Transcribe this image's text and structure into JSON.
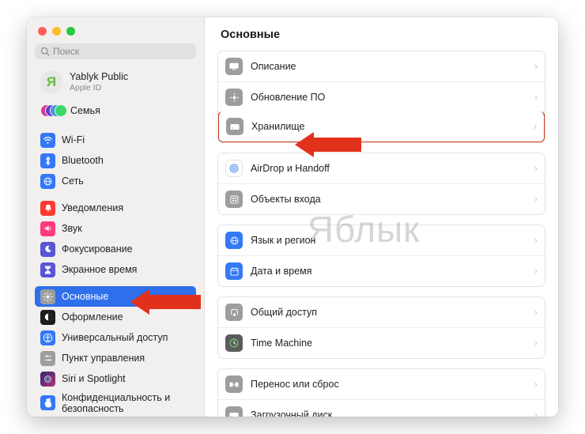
{
  "watermark": "Яблык",
  "colors": {
    "accent_blue": "#2f6fec",
    "highlight_red": "#cf3a25",
    "arrow_red": "#e2311b"
  },
  "search": {
    "placeholder": "Поиск"
  },
  "account": {
    "name": "Yablyk Public",
    "sub": "Apple ID"
  },
  "sidebar": {
    "family": "Семья",
    "items": [
      {
        "label": "Wi-Fi"
      },
      {
        "label": "Bluetooth"
      },
      {
        "label": "Сеть"
      },
      {
        "label": "Уведомления"
      },
      {
        "label": "Звук"
      },
      {
        "label": "Фокусирование"
      },
      {
        "label": "Экранное время"
      },
      {
        "label": "Основные"
      },
      {
        "label": "Оформление"
      },
      {
        "label": "Универсальный доступ"
      },
      {
        "label": "Пункт управления"
      },
      {
        "label": "Siri и Spotlight"
      },
      {
        "label": "Конфиденциальность и безопасность"
      }
    ]
  },
  "main": {
    "title": "Основные",
    "groups": [
      [
        {
          "label": "Описание",
          "icon": "about-icon"
        },
        {
          "label": "Обновление ПО",
          "icon": "update-icon"
        },
        {
          "label": "Хранилище",
          "icon": "storage-icon",
          "highlighted": true
        }
      ],
      [
        {
          "label": "AirDrop и Handoff",
          "icon": "airdrop-icon"
        },
        {
          "label": "Объекты входа",
          "icon": "login-items-icon"
        }
      ],
      [
        {
          "label": "Язык и регион",
          "icon": "language-icon"
        },
        {
          "label": "Дата и время",
          "icon": "datetime-icon"
        }
      ],
      [
        {
          "label": "Общий доступ",
          "icon": "sharing-icon"
        },
        {
          "label": "Time Machine",
          "icon": "timemachine-icon"
        }
      ],
      [
        {
          "label": "Перенос или сброс",
          "icon": "transfer-icon"
        },
        {
          "label": "Загрузочный диск",
          "icon": "startup-icon"
        }
      ]
    ]
  }
}
